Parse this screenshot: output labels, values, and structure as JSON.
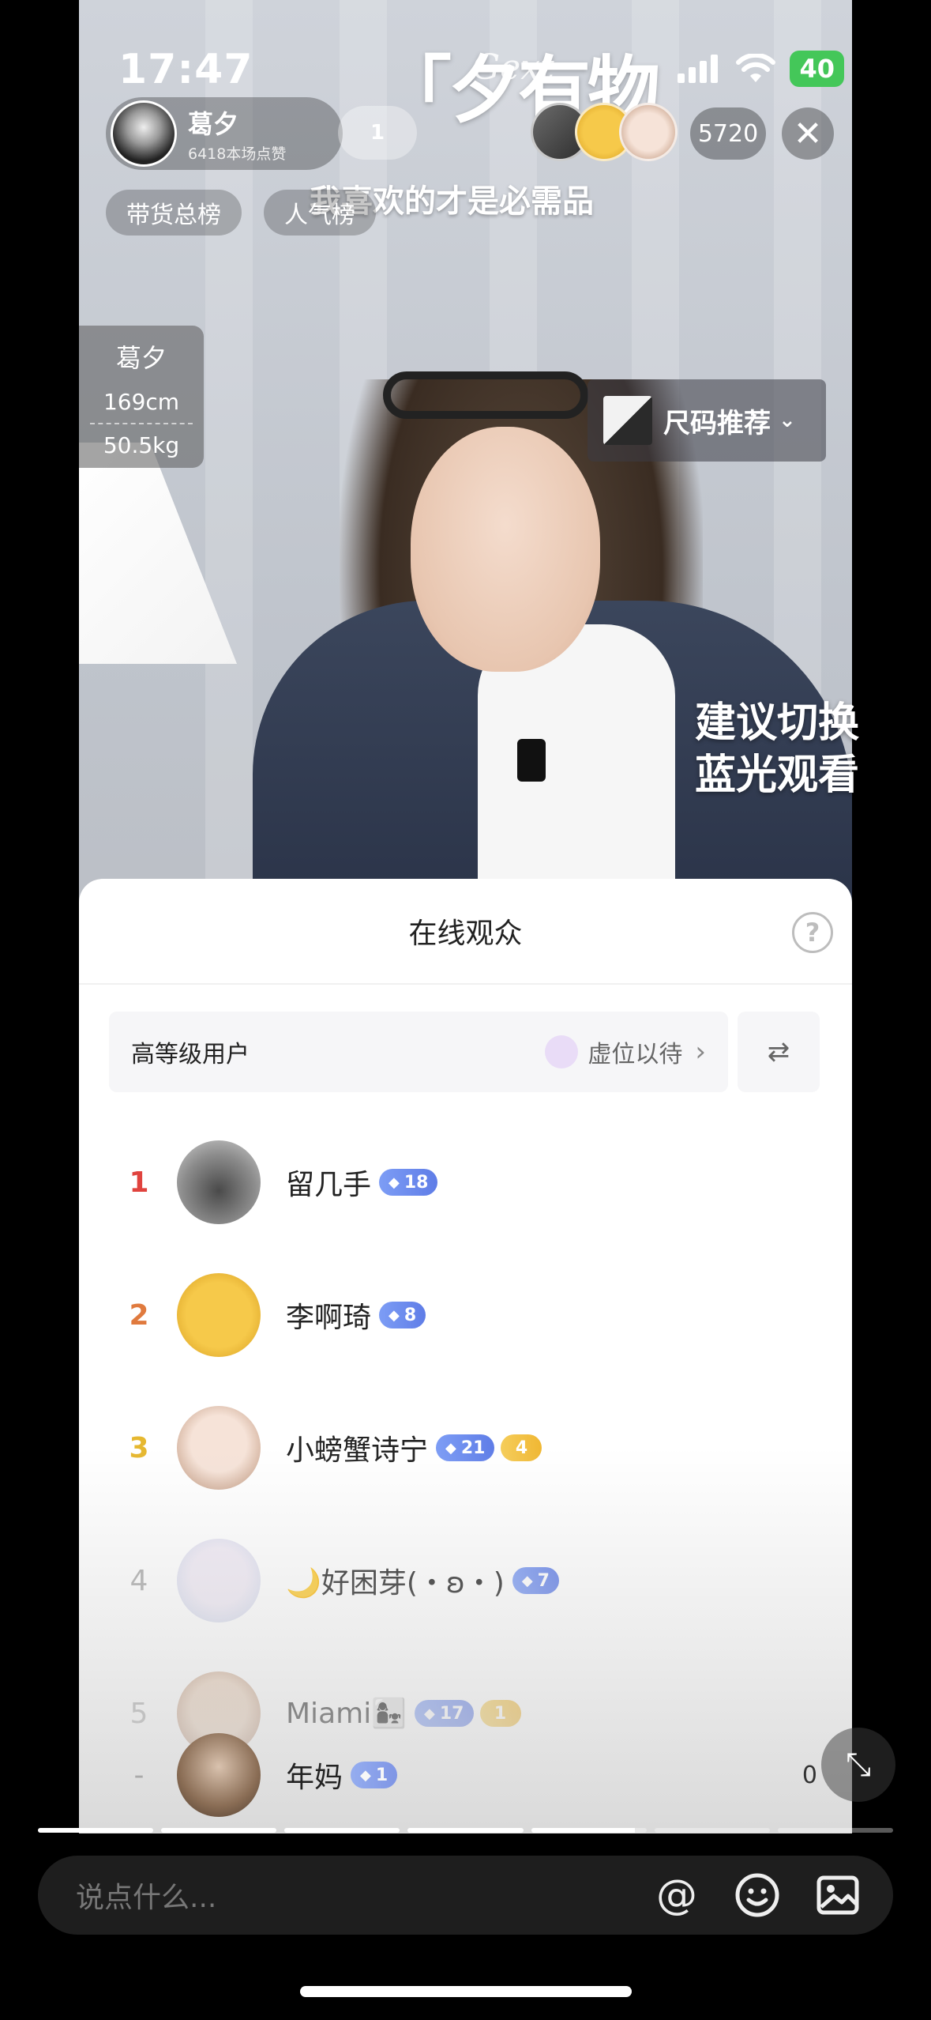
{
  "status_bar": {
    "time": "17:47",
    "battery": "40"
  },
  "host": {
    "name": "葛夕",
    "likes": "6418本场点赞",
    "follow_count": "1"
  },
  "brand": {
    "title": "「夕有物",
    "subtitle": "Gext",
    "slogan": "我喜欢的才是必需品"
  },
  "viewer_count": "5720",
  "tags": [
    "带货总榜",
    "人气榜"
  ],
  "size_card": {
    "name": "葛夕",
    "height": "169cm",
    "weight": "50.5kg"
  },
  "size_recommend": "尺码推荐",
  "bluray_hint": [
    "建议切换",
    "蓝光观看"
  ],
  "panel": {
    "title": "在线观众",
    "filter_label": "高等级用户",
    "reserve_text": "虚位以待",
    "viewers": [
      {
        "rank": "1",
        "name": "留几手",
        "level": "18",
        "fan": ""
      },
      {
        "rank": "2",
        "name": "李啊琦",
        "level": "8",
        "fan": ""
      },
      {
        "rank": "3",
        "name": "小螃蟹诗宁",
        "level": "21",
        "fan": "4"
      },
      {
        "rank": "4",
        "name": "🌙好困芽(・ʚ・)",
        "level": "7",
        "fan": ""
      },
      {
        "rank": "5",
        "name": "Miami👩‍👧",
        "level": "17",
        "fan": "1"
      }
    ],
    "self": {
      "rank": "-",
      "name": "年妈",
      "level": "1",
      "score": "0"
    }
  },
  "progress": [
    1,
    1,
    1,
    1,
    0.9,
    0,
    0
  ],
  "comment_placeholder": "说点什么...",
  "colors": {
    "rank1": "#e0433e",
    "rank2": "#e07a3e",
    "rank3": "#e6b830",
    "rank_other": "#aaaaaa"
  }
}
